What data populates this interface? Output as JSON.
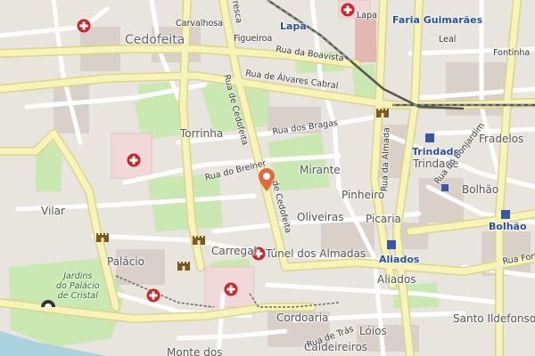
{
  "map": {
    "districts": {
      "cedofeita": "Cedofeita",
      "lapa_district": "Lapa",
      "faria_guimaraes": "Faria Guimarães",
      "trindade_station": "Trindade",
      "bolhao_station": "Bolhão",
      "aliados_station": "Aliados"
    },
    "places": {
      "carvalhosa": "Carvalhosa",
      "lapa_small": "Lapa",
      "leal": "Leal",
      "fontinha": "Fontinha",
      "torrinha": "Torrinha",
      "mirante": "Mirante",
      "pinheiro": "Pinheiro",
      "oliveiras": "Oliveiras",
      "picaria": "Picaria",
      "fradelos": "Fradelos",
      "trindade": "Trindade",
      "bolhao": "Bolhão",
      "vilar": "Vilar",
      "palacio": "Palácio",
      "carregal": "Carregal",
      "aliados": "Aliados",
      "cordoaria": "Cordoaria",
      "santo_ildefonso": "Santo Ildefonso",
      "loios": "Lóios",
      "caldeireiros": "Caldeireiros",
      "monte_dos": "Monte dos",
      "tunel_dos_almadas": "Túnel dos Almadas",
      "jardins": "Jardins\ndo Palácio\nde Cristal",
      "figueiroa": "Figueiroa"
    },
    "streets": {
      "rua_da_boavista": "Rua da Boavista",
      "rua_de_alvares_cabral": "Rua de Álvares Cabral",
      "rua_de_cedofeita_north": "Rua de Cedofeita",
      "rua_de_cedofeita_south": "de Cedofeita",
      "rua_dos_bragas": "Rua dos Bragas",
      "rua_do_breiner": "Rua do Breiner",
      "rua_da_almada": "Rua da Almada",
      "rua_do_bonjardim": "Rua do Bonjardim",
      "rua_formosa": "Rua Form",
      "rua_de_tras": "Rua de Trás",
      "fresca": "resca"
    },
    "colors": {
      "background": "#e8e4de",
      "main_road": "#f7f4b9",
      "main_road_casing": "#dcd48a",
      "street": "#ffffff",
      "park": "#c9e8b2",
      "hospital": "#c9262c",
      "marker": "#e4683a",
      "metro": "#3a55a4"
    },
    "icons": [
      "hospital-icon",
      "castle-icon",
      "metro-icon",
      "map-pin-icon",
      "tunnel-icon"
    ]
  }
}
